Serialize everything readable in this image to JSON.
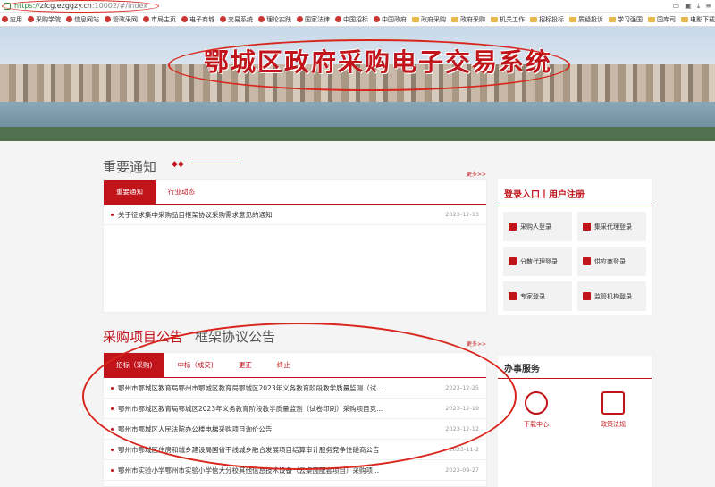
{
  "browser": {
    "url_proto": "https://",
    "url_host": "zfcg.ezggzy.cn",
    "url_path": ":10002/#/index"
  },
  "bookmarks": [
    "应用",
    "采购学院",
    "信息网站",
    "管政采网",
    "市局主页",
    "电子商城",
    "交易系统",
    "理论实践",
    "国家法律",
    "中国招标",
    "中国政府",
    "政府采购",
    "政府采购",
    "机关工作",
    "招标投标",
    "质疑投诉",
    "学习强国",
    "国库司",
    "电影下载"
  ],
  "banner": {
    "title": "鄂城区政府采购电子交易系统"
  },
  "notice": {
    "title": "重要通知",
    "more": "更多>>",
    "tabs": [
      "重要通知",
      "行业动态"
    ],
    "items": [
      {
        "text": "关于征求集中采购品目框架协议采购需求意见的通知",
        "date": "2023-12-13"
      }
    ]
  },
  "login": {
    "title": "登录入口丨用户注册",
    "buttons": [
      "采购人登录",
      "集采代理登录",
      "分散代理登录",
      "供应商登录",
      "专家登录",
      "监管机构登录"
    ]
  },
  "procurement": {
    "tab_a": "采购项目公告",
    "tab_b": "框架协议公告",
    "more": "更多>>",
    "tabs": [
      "招标（采购)",
      "中标（成交)",
      "更正",
      "终止"
    ],
    "items": [
      {
        "text": "鄂州市鄂城区教育局鄂州市鄂城区教育局鄂城区2023年义务教育阶段教学质量监测（试...",
        "date": "2023-12-25"
      },
      {
        "text": "鄂州市鄂城区教育局鄂城区2023年义务教育阶段教学质量监测（试卷印刷）采购项目竞...",
        "date": "2023-12-19"
      },
      {
        "text": "鄂州市鄂城区人民法院办公楼电梯采购项目询价公告",
        "date": "2023-12-12"
      },
      {
        "text": "鄂州市鄂城区住房和城乡建设局国省干线城乡融合发展项目结算审计服务竞争性磋商公告",
        "date": "2023-11-2"
      },
      {
        "text": "鄂州市实验小学鄂州市实验小学信大分校其他信息技术设备（云桌面配套项目）采购项...",
        "date": "2023-09-27"
      }
    ]
  },
  "services": {
    "title": "办事服务",
    "items": [
      "下载中心",
      "政策法规"
    ]
  }
}
